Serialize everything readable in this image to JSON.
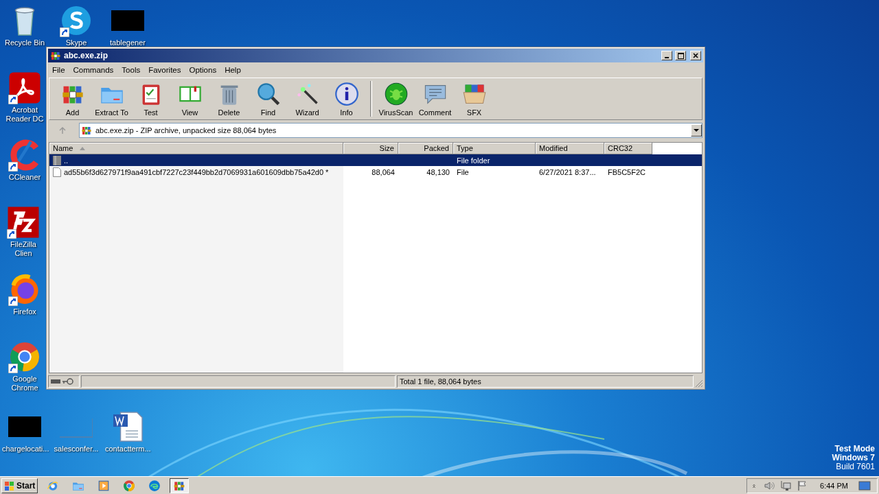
{
  "desktop_icons": [
    {
      "label": "Recycle Bin",
      "kind": "recycle",
      "shortcut": false
    },
    {
      "label": "Skype",
      "kind": "skype",
      "shortcut": true
    },
    {
      "label": "tablegener",
      "kind": "black-thumb",
      "shortcut": false
    },
    {
      "label": "Acrobat Reader DC",
      "kind": "acrobat",
      "shortcut": true
    },
    {
      "label": "CCleaner",
      "kind": "ccleaner",
      "shortcut": true
    },
    {
      "label": "FileZilla Clien",
      "kind": "filezilla",
      "shortcut": true
    },
    {
      "label": "Firefox",
      "kind": "firefox",
      "shortcut": true
    },
    {
      "label": "Google Chrome",
      "kind": "chrome",
      "shortcut": true
    },
    {
      "label": "chargelocati...",
      "kind": "black-thumb",
      "shortcut": false
    },
    {
      "label": "salesconfer...",
      "kind": "blank-thumb",
      "shortcut": false
    },
    {
      "label": "contactterm...",
      "kind": "word-doc",
      "shortcut": false
    }
  ],
  "window": {
    "title": "abc.exe.zip",
    "menu": [
      "File",
      "Commands",
      "Tools",
      "Favorites",
      "Options",
      "Help"
    ],
    "toolbar_groups": [
      [
        {
          "label": "Add",
          "kind": "add"
        },
        {
          "label": "Extract To",
          "kind": "extract"
        },
        {
          "label": "Test",
          "kind": "test"
        },
        {
          "label": "View",
          "kind": "view"
        },
        {
          "label": "Delete",
          "kind": "delete"
        },
        {
          "label": "Find",
          "kind": "find"
        },
        {
          "label": "Wizard",
          "kind": "wizard"
        },
        {
          "label": "Info",
          "kind": "info"
        }
      ],
      [
        {
          "label": "VirusScan",
          "kind": "virusscan"
        },
        {
          "label": "Comment",
          "kind": "comment"
        },
        {
          "label": "SFX",
          "kind": "sfx"
        }
      ]
    ],
    "address": "abc.exe.zip - ZIP archive, unpacked size 88,064 bytes",
    "columns": [
      {
        "label": "Name",
        "sorted": true
      },
      {
        "label": "Size",
        "sorted": false
      },
      {
        "label": "Packed",
        "sorted": false
      },
      {
        "label": "Type",
        "sorted": false
      },
      {
        "label": "Modified",
        "sorted": false
      },
      {
        "label": "CRC32",
        "sorted": false
      }
    ],
    "rows": [
      {
        "kind": "folder",
        "selected": true,
        "cells": [
          "..",
          "",
          "",
          "File folder",
          "",
          ""
        ]
      },
      {
        "kind": "file",
        "selected": false,
        "cells": [
          "ad55b6f3d627971f9aa491cbf7227c23f449bb2d7069931a601609dbb75a42d0 *",
          "88,064",
          "48,130",
          "File",
          "6/27/2021 8:37...",
          "FB5C5F2C"
        ]
      }
    ],
    "status": "Total 1 file, 88,064 bytes"
  },
  "os_notice": [
    "Test Mode",
    "Windows 7",
    "Build 7601"
  ],
  "taskbar": {
    "start": "Start",
    "apps": [
      {
        "kind": "ie",
        "active": false
      },
      {
        "kind": "explorer",
        "active": false
      },
      {
        "kind": "media",
        "active": false
      },
      {
        "kind": "chrome",
        "active": false
      },
      {
        "kind": "edge",
        "active": false
      },
      {
        "kind": "winrar",
        "active": true
      }
    ],
    "clock": "6:44 PM"
  }
}
